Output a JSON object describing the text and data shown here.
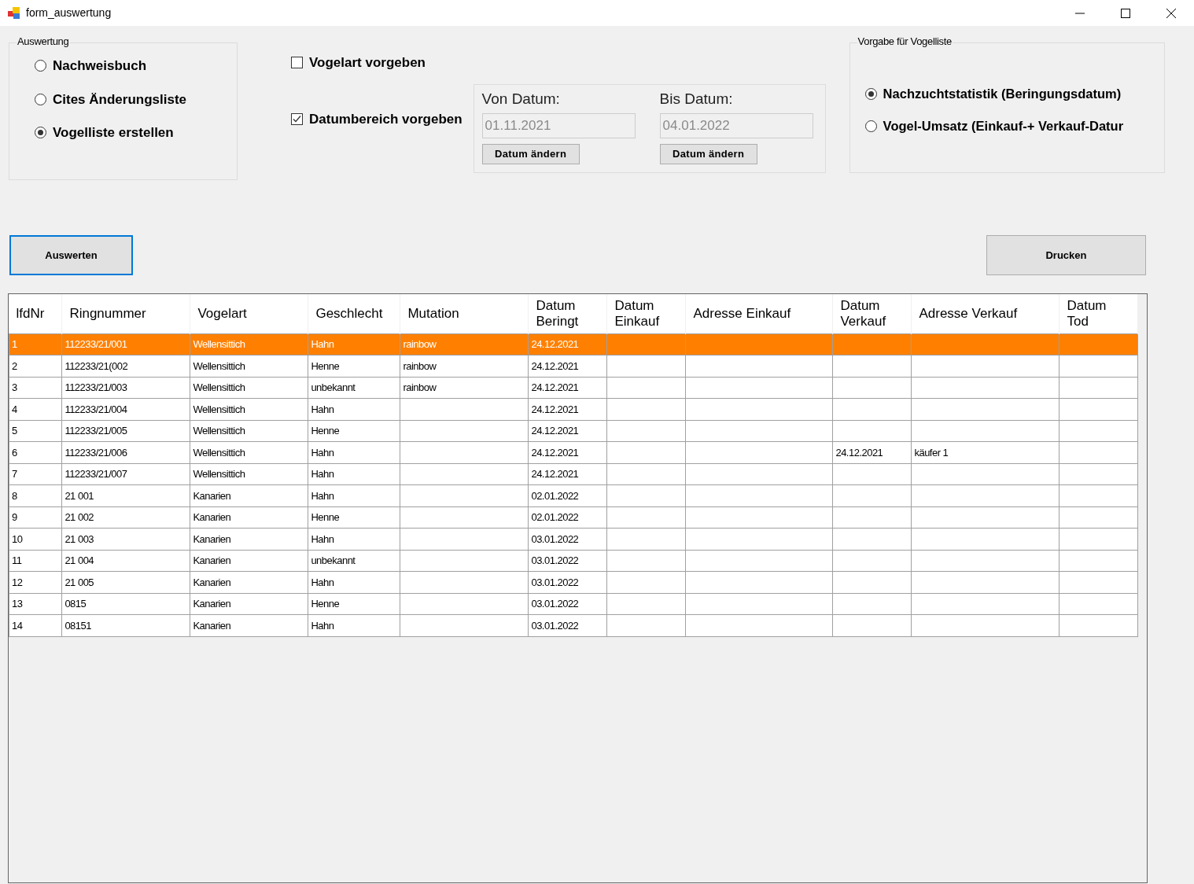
{
  "window": {
    "title": "form_auswertung"
  },
  "auswertung": {
    "title": "Auswertung",
    "options": [
      {
        "label": "Nachweisbuch",
        "selected": false
      },
      {
        "label": "Cites Änderungsliste",
        "selected": false
      },
      {
        "label": "Vogelliste erstellen",
        "selected": true
      }
    ]
  },
  "checkboxes": [
    {
      "label": "Vogelart vorgeben",
      "checked": false
    },
    {
      "label": "Datumbereich vorgeben",
      "checked": true
    }
  ],
  "date_range": [
    {
      "label": "Von Datum:",
      "value": "01.11.2021",
      "disabled": true,
      "button": "Datum ändern"
    },
    {
      "label": "Bis Datum:",
      "value": "04.01.2022",
      "disabled": true,
      "button": "Datum ändern"
    }
  ],
  "vorgabe": {
    "title": "Vorgabe für Vogelliste",
    "options": [
      {
        "label": "Nachzuchtstatistik (Beringungsdatum)",
        "selected": true
      },
      {
        "label": "Vogel-Umsatz (Einkauf-+ Verkauf-Datur",
        "selected": false
      }
    ]
  },
  "buttons": {
    "evaluate": "Auswerten",
    "print": "Drucken"
  },
  "table": {
    "columns": [
      "lfdNr",
      "Ringnummer",
      "Vogelart",
      "Geschlecht",
      "Mutation",
      "Datum Beringt",
      "Datum Einkauf",
      "Adresse Einkauf",
      "Datum Verkauf",
      "Adresse Verkauf",
      "Datum Tod"
    ],
    "rows": [
      {
        "selected": true,
        "cells": [
          "1",
          "112233/21/001",
          "Wellensittich",
          "Hahn",
          "rainbow",
          "24.12.2021",
          null,
          null,
          null,
          null,
          null
        ]
      },
      {
        "selected": false,
        "cells": [
          "2",
          "112233/21(002",
          "Wellensittich",
          "Henne",
          "rainbow",
          "24.12.2021",
          null,
          null,
          null,
          null,
          null
        ]
      },
      {
        "selected": false,
        "cells": [
          "3",
          "112233/21/003",
          "Wellensittich",
          "unbekannt",
          "rainbow",
          "24.12.2021",
          null,
          null,
          null,
          null,
          null
        ]
      },
      {
        "selected": false,
        "cells": [
          "4",
          "112233/21/004",
          "Wellensittich",
          "Hahn",
          null,
          "24.12.2021",
          null,
          null,
          null,
          null,
          null
        ]
      },
      {
        "selected": false,
        "cells": [
          "5",
          "112233/21/005",
          "Wellensittich",
          "Henne",
          null,
          "24.12.2021",
          null,
          null,
          null,
          null,
          null
        ]
      },
      {
        "selected": false,
        "cells": [
          "6",
          "112233/21/006",
          "Wellensittich",
          "Hahn",
          null,
          "24.12.2021",
          null,
          null,
          "24.12.2021",
          "käufer 1",
          null
        ]
      },
      {
        "selected": false,
        "cells": [
          "7",
          "112233/21/007",
          "Wellensittich",
          "Hahn",
          null,
          "24.12.2021",
          null,
          null,
          null,
          null,
          null
        ]
      },
      {
        "selected": false,
        "cells": [
          "8",
          "21 001",
          "Kanarien",
          "Hahn",
          null,
          "02.01.2022",
          null,
          null,
          null,
          null,
          null
        ]
      },
      {
        "selected": false,
        "cells": [
          "9",
          "21 002",
          "Kanarien",
          "Henne",
          null,
          "02.01.2022",
          null,
          null,
          null,
          null,
          null
        ]
      },
      {
        "selected": false,
        "cells": [
          "10",
          "21 003",
          "Kanarien",
          "Hahn",
          null,
          "03.01.2022",
          null,
          null,
          null,
          null,
          null
        ]
      },
      {
        "selected": false,
        "cells": [
          "11",
          "21 004",
          "Kanarien",
          "unbekannt",
          null,
          "03.01.2022",
          null,
          null,
          null,
          null,
          null
        ]
      },
      {
        "selected": false,
        "cells": [
          "12",
          "21 005",
          "Kanarien",
          "Hahn",
          null,
          "03.01.2022",
          null,
          null,
          null,
          null,
          null
        ]
      },
      {
        "selected": false,
        "cells": [
          "13",
          "0815",
          "Kanarien",
          "Henne",
          null,
          "03.01.2022",
          null,
          null,
          null,
          null,
          null
        ]
      },
      {
        "selected": false,
        "cells": [
          "14",
          "08151",
          "Kanarien",
          "Hahn",
          null,
          "03.01.2022",
          null,
          null,
          null,
          null,
          null
        ]
      }
    ]
  }
}
